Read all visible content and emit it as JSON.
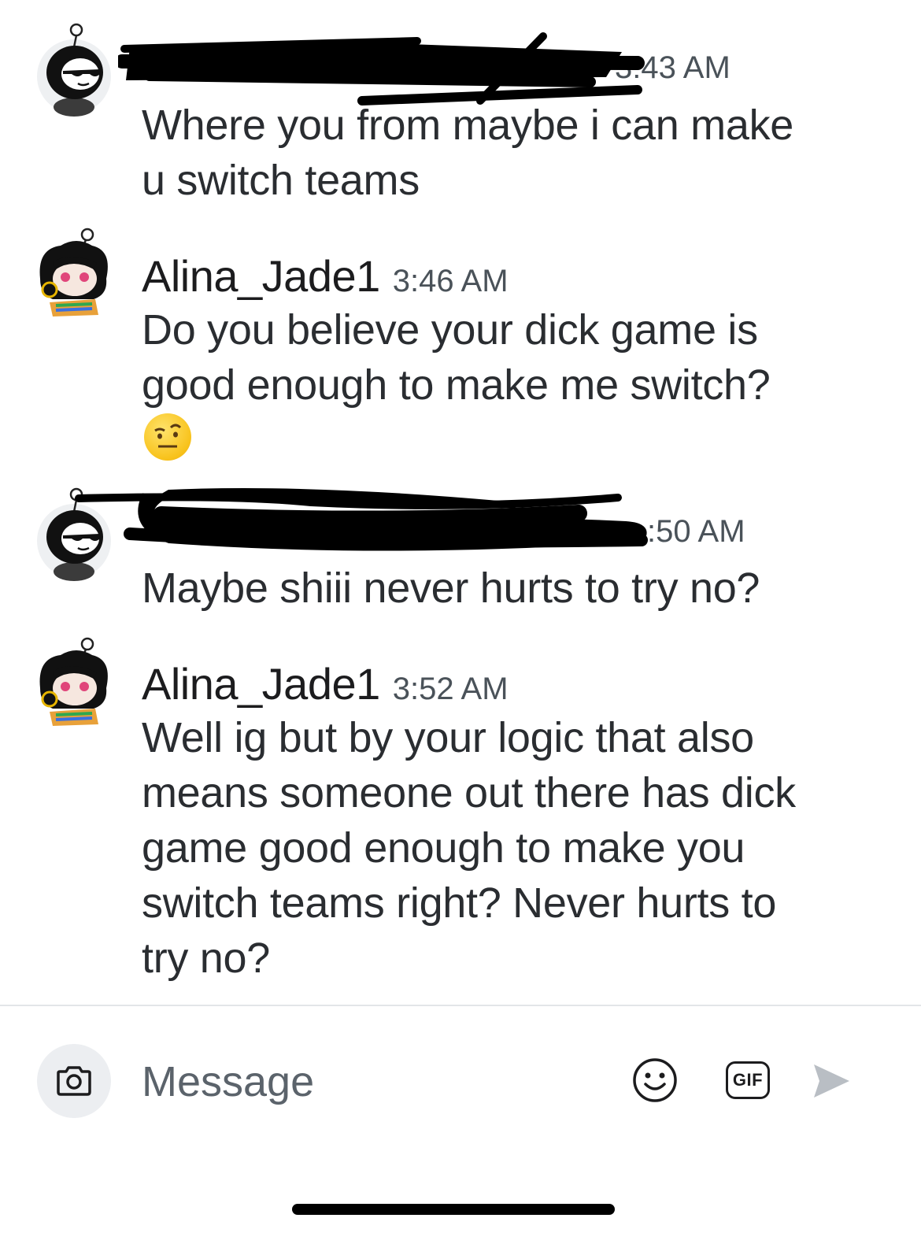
{
  "messages": [
    {
      "username": "",
      "time": "3:43 AM",
      "text_lines": [
        "Where you from maybe i can make",
        "u switch teams"
      ],
      "redacted": true
    },
    {
      "username": "Alina_Jade1",
      "time": "3:46 AM",
      "text_lines": [
        "Do you believe your dick game is",
        "good enough to make me switch?"
      ],
      "emoji": "raised-eyebrow-face"
    },
    {
      "username": "",
      "time": ":50 AM",
      "text_lines": [
        "Maybe shiii never hurts to try no?"
      ],
      "redacted": true
    },
    {
      "username": "Alina_Jade1",
      "time": "3:52 AM",
      "text_lines": [
        "Well ig but by your logic that also",
        "means someone out there has dick",
        "game good enough to make you",
        "switch teams right? Never hurts to",
        "try no?"
      ]
    }
  ],
  "composer": {
    "placeholder": "Message",
    "gif_label": "GIF",
    "icons": [
      "camera-icon",
      "emoji-icon",
      "gif-icon",
      "send-icon"
    ]
  },
  "colors": {
    "text": "#1c1c1e",
    "timestamp": "#4a5259",
    "placeholder": "#5b636b",
    "send_disabled": "#b9bec4",
    "redaction": "#000000"
  }
}
